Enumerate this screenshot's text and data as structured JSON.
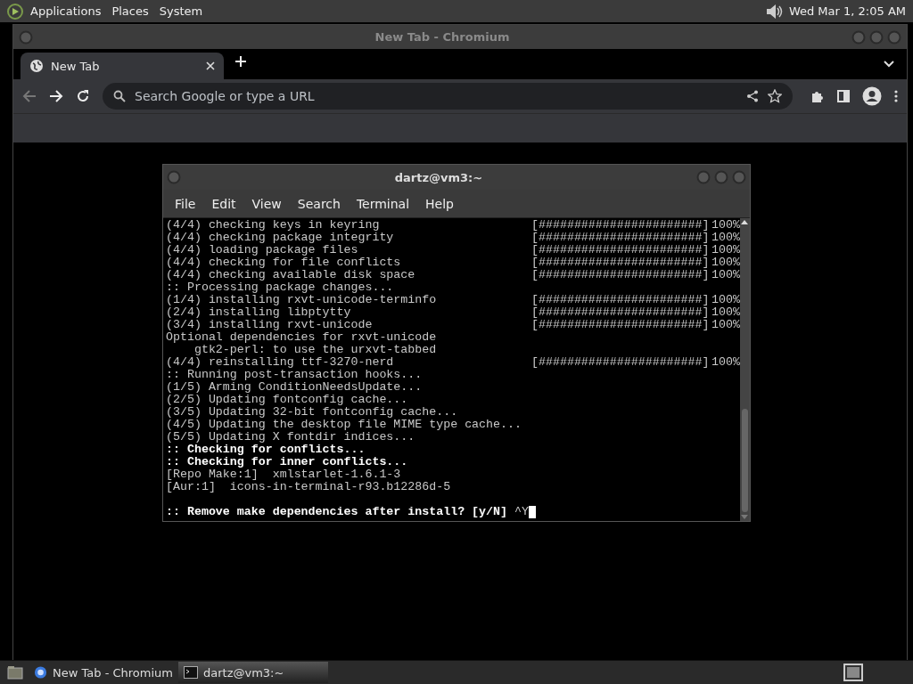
{
  "top_panel": {
    "menus": [
      "Applications",
      "Places",
      "System"
    ],
    "clock": "Wed Mar 1, 2:05 AM"
  },
  "browser": {
    "title": "New Tab - Chromium",
    "tabs": [
      {
        "label": "New Tab",
        "selected": true
      }
    ],
    "address_bar": {
      "placeholder": "Search Google or type a URL"
    }
  },
  "terminal": {
    "title": "dartz@vm3:~",
    "menu": [
      "File",
      "Edit",
      "View",
      "Search",
      "Terminal",
      "Help"
    ],
    "lines": [
      {
        "kind": "progress",
        "text": "(4/4) checking keys in keyring",
        "bar": "[#######################]",
        "percent": "100%"
      },
      {
        "kind": "progress",
        "text": "(4/4) checking package integrity",
        "bar": "[#######################]",
        "percent": "100%"
      },
      {
        "kind": "progress",
        "text": "(4/4) loading package files",
        "bar": "[#######################]",
        "percent": "100%"
      },
      {
        "kind": "progress",
        "text": "(4/4) checking for file conflicts",
        "bar": "[#######################]",
        "percent": "100%"
      },
      {
        "kind": "progress",
        "text": "(4/4) checking available disk space",
        "bar": "[#######################]",
        "percent": "100%"
      },
      {
        "kind": "plain",
        "text": ":: Processing package changes..."
      },
      {
        "kind": "progress",
        "text": "(1/4) installing rxvt-unicode-terminfo",
        "bar": "[#######################]",
        "percent": "100%"
      },
      {
        "kind": "progress",
        "text": "(2/4) installing libptytty",
        "bar": "[#######################]",
        "percent": "100%"
      },
      {
        "kind": "progress",
        "text": "(3/4) installing rxvt-unicode",
        "bar": "[#######################]",
        "percent": "100%"
      },
      {
        "kind": "plain",
        "text": "Optional dependencies for rxvt-unicode"
      },
      {
        "kind": "plain",
        "text": "    gtk2-perl: to use the urxvt-tabbed"
      },
      {
        "kind": "progress",
        "text": "(4/4) reinstalling ttf-3270-nerd",
        "bar": "[#######################]",
        "percent": "100%"
      },
      {
        "kind": "plain",
        "text": ":: Running post-transaction hooks..."
      },
      {
        "kind": "plain",
        "text": "(1/5) Arming ConditionNeedsUpdate..."
      },
      {
        "kind": "plain",
        "text": "(2/5) Updating fontconfig cache..."
      },
      {
        "kind": "plain",
        "text": "(3/5) Updating 32-bit fontconfig cache..."
      },
      {
        "kind": "plain",
        "text": "(4/5) Updating the desktop file MIME type cache..."
      },
      {
        "kind": "plain",
        "text": "(5/5) Updating X fontdir indices..."
      },
      {
        "kind": "bold",
        "text": ":: Checking for conflicts..."
      },
      {
        "kind": "bold",
        "text": ":: Checking for inner conflicts..."
      },
      {
        "kind": "plain",
        "text": "[Repo Make:1]  xmlstarlet-1.6.1-3"
      },
      {
        "kind": "plain",
        "text": "[Aur:1]  icons-in-terminal-r93.b12286d-5"
      },
      {
        "kind": "blank"
      },
      {
        "kind": "prompt",
        "text": ":: Remove make dependencies after install? [y/N]",
        "input": "^Y"
      }
    ]
  },
  "taskbar": {
    "items": [
      {
        "label": "New Tab - Chromium",
        "kind": "browser",
        "selected": false
      },
      {
        "label": "dartz@vm3:~",
        "kind": "terminal",
        "selected": true
      }
    ]
  }
}
